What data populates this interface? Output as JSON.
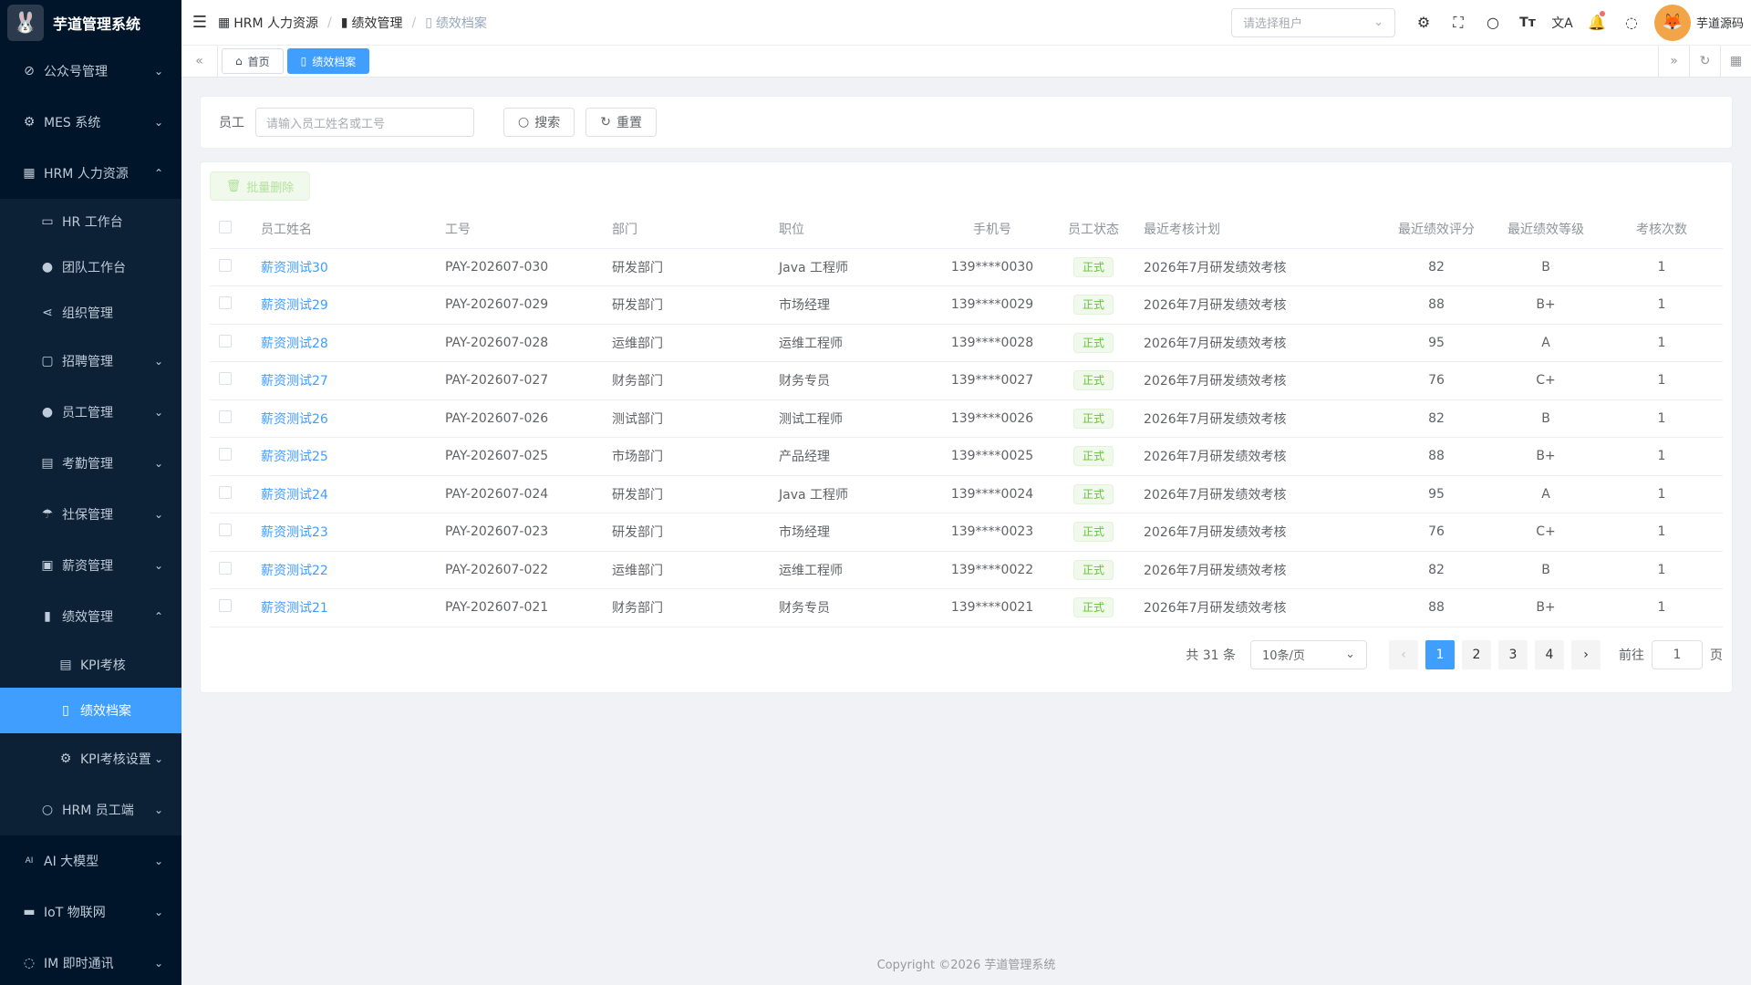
{
  "app": {
    "title": "芋道管理系统"
  },
  "sidebar": {
    "items": [
      {
        "label": "公众号管理",
        "icon": "gauge-icon",
        "arrow": "down"
      },
      {
        "label": "MES 系统",
        "icon": "chip-icon",
        "arrow": "down"
      },
      {
        "label": "HRM 人力资源",
        "icon": "building-icon",
        "arrow": "up"
      }
    ],
    "hrm_children": [
      {
        "label": "HR 工作台",
        "icon": "monitor-icon"
      },
      {
        "label": "团队工作台",
        "icon": "user-icon"
      },
      {
        "label": "组织管理",
        "icon": "share-icon"
      },
      {
        "label": "招聘管理",
        "icon": "briefcase-icon",
        "arrow": "down"
      },
      {
        "label": "员工管理",
        "icon": "user-icon",
        "arrow": "down"
      },
      {
        "label": "考勤管理",
        "icon": "calendar-icon",
        "arrow": "down"
      },
      {
        "label": "社保管理",
        "icon": "umbrella-icon",
        "arrow": "down"
      },
      {
        "label": "薪资管理",
        "icon": "wallet-icon",
        "arrow": "down"
      },
      {
        "label": "绩效管理",
        "icon": "bar-chart-icon",
        "arrow": "up"
      }
    ],
    "perf_children": [
      {
        "label": "KPI考核",
        "icon": "calendar-icon"
      },
      {
        "label": "绩效档案",
        "icon": "document-icon"
      },
      {
        "label": "KPI考核设置",
        "icon": "gear-icon",
        "arrow": "down"
      }
    ],
    "hrm_tail": [
      {
        "label": "HRM 员工端",
        "icon": "user-outline-icon",
        "arrow": "down"
      }
    ],
    "bottom_items": [
      {
        "label": "AI 大模型",
        "icon": "ai-icon",
        "arrow": "down"
      },
      {
        "label": "IoT 物联网",
        "icon": "car-icon",
        "arrow": "down"
      },
      {
        "label": "IM 即时通讯",
        "icon": "chat-icon",
        "arrow": "down"
      }
    ]
  },
  "header": {
    "breadcrumb": [
      "HRM 人力资源",
      "绩效管理",
      "绩效档案"
    ],
    "tenant_placeholder": "请选择租户",
    "user_name": "芋道源码"
  },
  "tags": {
    "home": "首页",
    "current": "绩效档案"
  },
  "search": {
    "employee_label": "员工",
    "employee_placeholder": "请输入员工姓名或工号",
    "search_label": "搜索",
    "reset_label": "重置"
  },
  "toolbar": {
    "batch_delete_label": "批量删除"
  },
  "table": {
    "columns": [
      "员工姓名",
      "工号",
      "部门",
      "职位",
      "手机号",
      "员工状态",
      "最近考核计划",
      "最近绩效评分",
      "最近绩效等级",
      "考核次数"
    ],
    "rows": [
      {
        "name": "薪资测试30",
        "no": "PAY-202607-030",
        "dept": "研发部门",
        "pos": "Java 工程师",
        "phone": "139****0030",
        "status": "正式",
        "plan": "2026年7月研发绩效考核",
        "score": "82",
        "grade": "B",
        "count": "1"
      },
      {
        "name": "薪资测试29",
        "no": "PAY-202607-029",
        "dept": "研发部门",
        "pos": "市场经理",
        "phone": "139****0029",
        "status": "正式",
        "plan": "2026年7月研发绩效考核",
        "score": "88",
        "grade": "B+",
        "count": "1"
      },
      {
        "name": "薪资测试28",
        "no": "PAY-202607-028",
        "dept": "运维部门",
        "pos": "运维工程师",
        "phone": "139****0028",
        "status": "正式",
        "plan": "2026年7月研发绩效考核",
        "score": "95",
        "grade": "A",
        "count": "1"
      },
      {
        "name": "薪资测试27",
        "no": "PAY-202607-027",
        "dept": "财务部门",
        "pos": "财务专员",
        "phone": "139****0027",
        "status": "正式",
        "plan": "2026年7月研发绩效考核",
        "score": "76",
        "grade": "C+",
        "count": "1"
      },
      {
        "name": "薪资测试26",
        "no": "PAY-202607-026",
        "dept": "测试部门",
        "pos": "测试工程师",
        "phone": "139****0026",
        "status": "正式",
        "plan": "2026年7月研发绩效考核",
        "score": "82",
        "grade": "B",
        "count": "1"
      },
      {
        "name": "薪资测试25",
        "no": "PAY-202607-025",
        "dept": "市场部门",
        "pos": "产品经理",
        "phone": "139****0025",
        "status": "正式",
        "plan": "2026年7月研发绩效考核",
        "score": "88",
        "grade": "B+",
        "count": "1"
      },
      {
        "name": "薪资测试24",
        "no": "PAY-202607-024",
        "dept": "研发部门",
        "pos": "Java 工程师",
        "phone": "139****0024",
        "status": "正式",
        "plan": "2026年7月研发绩效考核",
        "score": "95",
        "grade": "A",
        "count": "1"
      },
      {
        "name": "薪资测试23",
        "no": "PAY-202607-023",
        "dept": "研发部门",
        "pos": "市场经理",
        "phone": "139****0023",
        "status": "正式",
        "plan": "2026年7月研发绩效考核",
        "score": "76",
        "grade": "C+",
        "count": "1"
      },
      {
        "name": "薪资测试22",
        "no": "PAY-202607-022",
        "dept": "运维部门",
        "pos": "运维工程师",
        "phone": "139****0022",
        "status": "正式",
        "plan": "2026年7月研发绩效考核",
        "score": "82",
        "grade": "B",
        "count": "1"
      },
      {
        "name": "薪资测试21",
        "no": "PAY-202607-021",
        "dept": "财务部门",
        "pos": "财务专员",
        "phone": "139****0021",
        "status": "正式",
        "plan": "2026年7月研发绩效考核",
        "score": "88",
        "grade": "B+",
        "count": "1"
      }
    ]
  },
  "pagination": {
    "total_text": "共 31 条",
    "page_size": "10条/页",
    "pages": [
      "1",
      "2",
      "3",
      "4"
    ],
    "current": "1",
    "goto_label": "前往",
    "goto_value": "1",
    "page_suffix": "页"
  },
  "footer": {
    "copyright": "Copyright ©2026 芋道管理系统"
  },
  "colors": {
    "primary": "#409eff",
    "sidebar_bg": "#001529",
    "success": "#67c23a"
  }
}
